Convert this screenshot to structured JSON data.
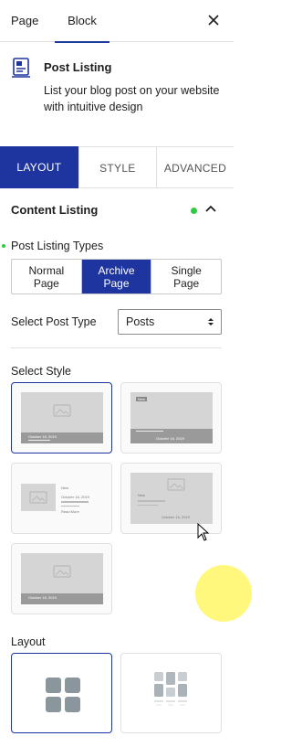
{
  "top_tabs": {
    "page": "Page",
    "block": "Block"
  },
  "block": {
    "title": "Post Listing",
    "description": "List your blog post on your website with intuitive design"
  },
  "panel_tabs": [
    "LAYOUT",
    "STYLE",
    "ADVANCED"
  ],
  "content_listing": {
    "heading": "Content Listing",
    "post_listing_types_label": "Post Listing Types",
    "types": [
      {
        "line1": "Normal",
        "line2": "Page"
      },
      {
        "line1": "Archive",
        "line2": "Page"
      },
      {
        "line1": "Single",
        "line2": "Page"
      }
    ],
    "active_type_index": 1,
    "select_post_type_label": "Select Post Type",
    "select_post_type_value": "Posts",
    "select_style_label": "Select Style",
    "style_thumb_texts": {
      "date": "October 16, 2019",
      "new": "New",
      "read_more": "Read More"
    },
    "layout_label": "Layout"
  },
  "colors": {
    "accent": "#1e35a0",
    "status_dot": "#2ecc40"
  }
}
